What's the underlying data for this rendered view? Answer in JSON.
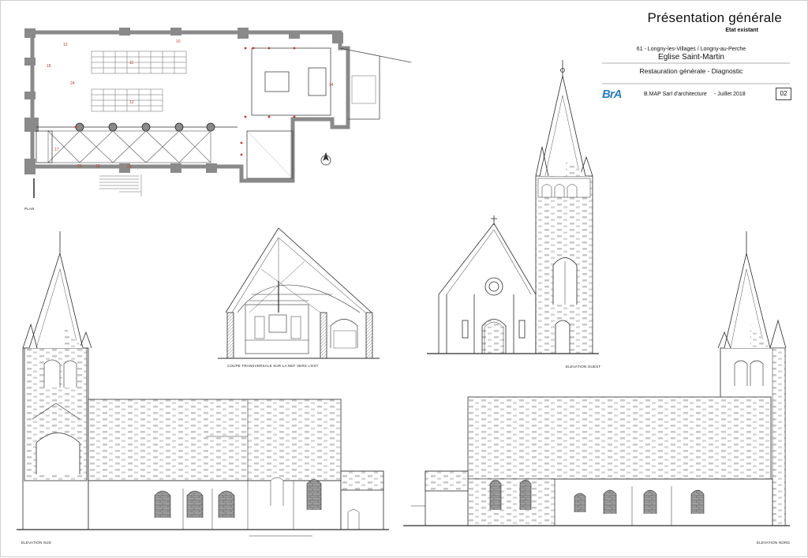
{
  "title_block": {
    "title": "Présentation générale",
    "subtitle": "Etat existant",
    "location": "61 - Longny-les-Villages / Longny-au-Perche",
    "church": "Eglise Saint-Martin",
    "project": "Restauration générale - Diagnostic",
    "logo": "BrA",
    "firm": "B.MAP Sarl d'architecture",
    "date": "-  Juillet 2018",
    "sheet_number": "02"
  },
  "drawings": {
    "plan_label": "Plan",
    "section_label": "Coupe transversale sur la nef vers l'est",
    "west_label": "Elevation ouest",
    "south_label": "Elevation sud",
    "north_label": "Elevation nord"
  },
  "plan_room_numbers": [
    "13",
    "10",
    "18",
    "24",
    "11",
    "12",
    "17",
    "20",
    "13",
    "21",
    "14"
  ],
  "colors": {
    "line": "#2b2b2b",
    "wall_fill": "#8c8c8c",
    "stone": "#b9b9b9",
    "accent_red": "#c0392b",
    "logo_blue": "#2a7fb8"
  }
}
